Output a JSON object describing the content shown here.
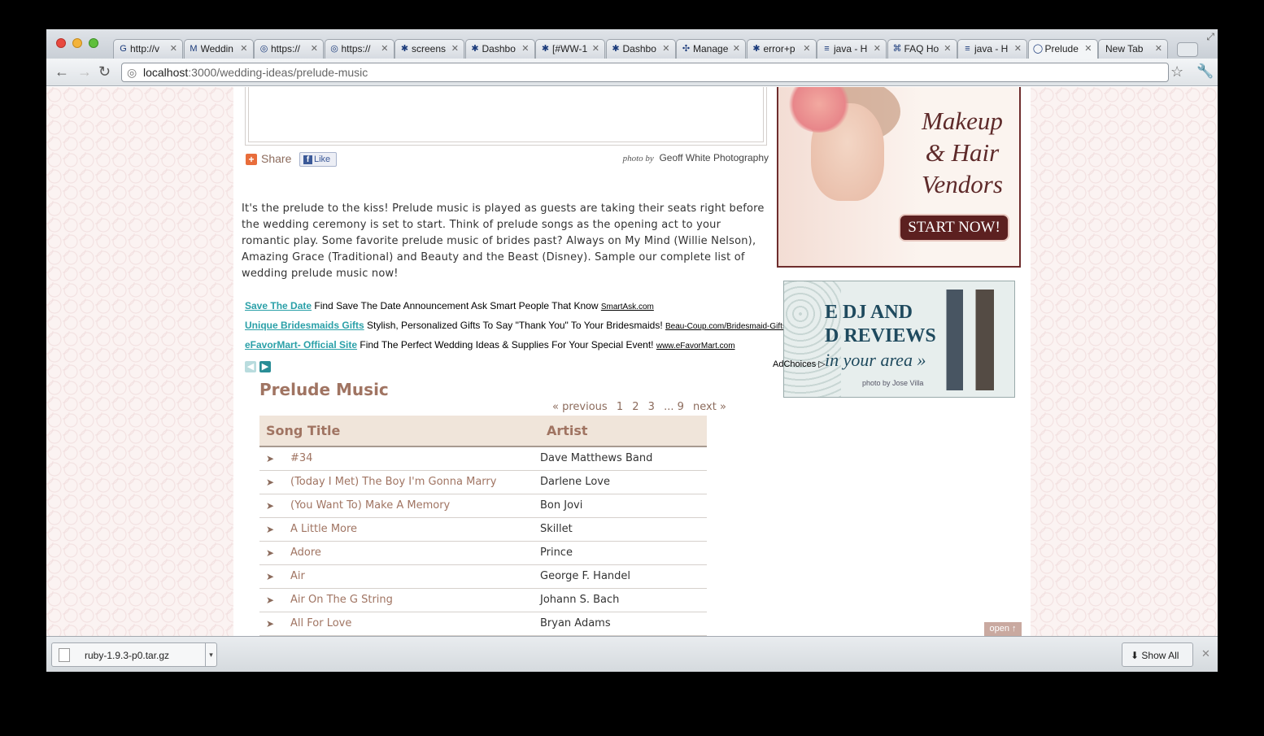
{
  "browser": {
    "tabs": [
      {
        "label": "http://v",
        "icon": "G"
      },
      {
        "label": "Weddin",
        "icon": "M"
      },
      {
        "label": "https://",
        "icon": "◎"
      },
      {
        "label": "https://",
        "icon": "◎"
      },
      {
        "label": "screens",
        "icon": "✱"
      },
      {
        "label": "Dashbo",
        "icon": "✱"
      },
      {
        "label": "[#WW-1",
        "icon": "✱"
      },
      {
        "label": "Dashbo",
        "icon": "✱"
      },
      {
        "label": "Manage",
        "icon": "✣"
      },
      {
        "label": "error+p",
        "icon": "✱"
      },
      {
        "label": "java - H",
        "icon": "≡"
      },
      {
        "label": "FAQ Ho",
        "icon": "⌘"
      },
      {
        "label": "java - H",
        "icon": "≡"
      },
      {
        "label": "Prelude",
        "icon": "◯"
      },
      {
        "label": "New Tab",
        "icon": ""
      }
    ],
    "url_host": "localhost",
    "url_path": ":3000/wedding-ideas/prelude-music"
  },
  "share": {
    "label": "Share",
    "like_label": "Like"
  },
  "photo_credit": {
    "prefix": "photo by",
    "name": "Geoff White Photography"
  },
  "intro_text": "It's the prelude to the kiss! Prelude music is played as guests are taking their seats right before the wedding ceremony is set to start. Think of prelude songs as the opening act to your romantic play. Some favorite prelude music of brides past? Always on My Mind (Willie Nelson), Amazing Grace (Traditional) and Beauty and the Beast (Disney). Sample our complete list of wedding prelude music now!",
  "ads": [
    {
      "link": "Save The Date",
      "text": "Find Save The Date Announcement Ask Smart People That Know",
      "domain": "SmartAsk.com"
    },
    {
      "link": "Unique Bridesmaids Gifts",
      "text": "Stylish, Personalized Gifts To Say \"Thank You\" To Your Bridesmaids!",
      "domain": "Beau-Coup.com/Bridesmaid-Gifts"
    },
    {
      "link": "eFavorMart- Official Site",
      "text": "Find The Perfect Wedding Ideas & Supplies For Your Special Event!",
      "domain": "www.eFavorMart.com"
    }
  ],
  "adchoices": "AdChoices ▷",
  "section_title": "Prelude Music",
  "pagination": {
    "previous": "« previous",
    "pages": [
      "1",
      "2",
      "3",
      "... 9"
    ],
    "next": "next »"
  },
  "table": {
    "headers": [
      "Song Title",
      "Artist"
    ],
    "rows": [
      {
        "title": "#34",
        "artist": "Dave Matthews Band"
      },
      {
        "title": "(Today I Met) The Boy I'm Gonna Marry",
        "artist": "Darlene Love"
      },
      {
        "title": "(You Want To) Make A Memory",
        "artist": "Bon Jovi"
      },
      {
        "title": "A Little More",
        "artist": "Skillet"
      },
      {
        "title": "Adore",
        "artist": "Prince"
      },
      {
        "title": "Air",
        "artist": "George F. Handel"
      },
      {
        "title": "Air On The G String",
        "artist": "Johann S. Bach"
      },
      {
        "title": "All For Love",
        "artist": "Bryan Adams"
      }
    ]
  },
  "makeup_ad": {
    "line1": "Makeup",
    "line2": "& Hair",
    "line3": "Vendors",
    "button": "START NOW!"
  },
  "dj_ad": {
    "line1": "E DJ AND",
    "line2": "D REVIEWS",
    "line3": "in your area »",
    "credit": "photo by Jose Villa"
  },
  "open_tab": "open ↑",
  "downloads": {
    "file": "ruby-1.9.3-p0.tar.gz",
    "show_all": "Show All"
  },
  "colors": {
    "accent": "#a07462",
    "ad_link": "#2aa0a8",
    "ad_border": "#6e2d2d"
  }
}
